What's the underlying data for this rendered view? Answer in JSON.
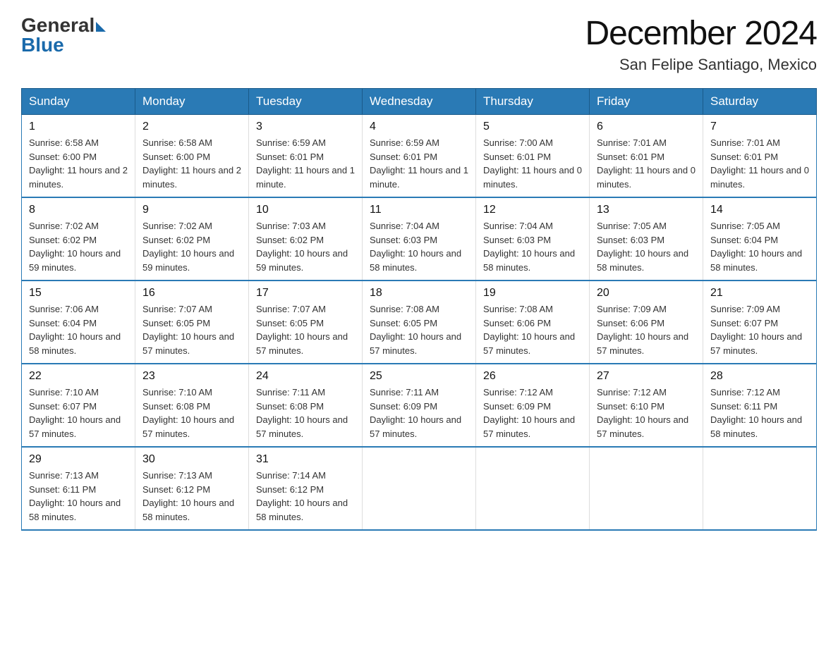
{
  "header": {
    "logo_general": "General",
    "logo_blue": "Blue",
    "month_title": "December 2024",
    "location": "San Felipe Santiago, Mexico"
  },
  "weekdays": [
    "Sunday",
    "Monday",
    "Tuesday",
    "Wednesday",
    "Thursday",
    "Friday",
    "Saturday"
  ],
  "weeks": [
    [
      {
        "day": "1",
        "sunrise": "6:58 AM",
        "sunset": "6:00 PM",
        "daylight": "11 hours and 2 minutes."
      },
      {
        "day": "2",
        "sunrise": "6:58 AM",
        "sunset": "6:00 PM",
        "daylight": "11 hours and 2 minutes."
      },
      {
        "day": "3",
        "sunrise": "6:59 AM",
        "sunset": "6:01 PM",
        "daylight": "11 hours and 1 minute."
      },
      {
        "day": "4",
        "sunrise": "6:59 AM",
        "sunset": "6:01 PM",
        "daylight": "11 hours and 1 minute."
      },
      {
        "day": "5",
        "sunrise": "7:00 AM",
        "sunset": "6:01 PM",
        "daylight": "11 hours and 0 minutes."
      },
      {
        "day": "6",
        "sunrise": "7:01 AM",
        "sunset": "6:01 PM",
        "daylight": "11 hours and 0 minutes."
      },
      {
        "day": "7",
        "sunrise": "7:01 AM",
        "sunset": "6:01 PM",
        "daylight": "11 hours and 0 minutes."
      }
    ],
    [
      {
        "day": "8",
        "sunrise": "7:02 AM",
        "sunset": "6:02 PM",
        "daylight": "10 hours and 59 minutes."
      },
      {
        "day": "9",
        "sunrise": "7:02 AM",
        "sunset": "6:02 PM",
        "daylight": "10 hours and 59 minutes."
      },
      {
        "day": "10",
        "sunrise": "7:03 AM",
        "sunset": "6:02 PM",
        "daylight": "10 hours and 59 minutes."
      },
      {
        "day": "11",
        "sunrise": "7:04 AM",
        "sunset": "6:03 PM",
        "daylight": "10 hours and 58 minutes."
      },
      {
        "day": "12",
        "sunrise": "7:04 AM",
        "sunset": "6:03 PM",
        "daylight": "10 hours and 58 minutes."
      },
      {
        "day": "13",
        "sunrise": "7:05 AM",
        "sunset": "6:03 PM",
        "daylight": "10 hours and 58 minutes."
      },
      {
        "day": "14",
        "sunrise": "7:05 AM",
        "sunset": "6:04 PM",
        "daylight": "10 hours and 58 minutes."
      }
    ],
    [
      {
        "day": "15",
        "sunrise": "7:06 AM",
        "sunset": "6:04 PM",
        "daylight": "10 hours and 58 minutes."
      },
      {
        "day": "16",
        "sunrise": "7:07 AM",
        "sunset": "6:05 PM",
        "daylight": "10 hours and 57 minutes."
      },
      {
        "day": "17",
        "sunrise": "7:07 AM",
        "sunset": "6:05 PM",
        "daylight": "10 hours and 57 minutes."
      },
      {
        "day": "18",
        "sunrise": "7:08 AM",
        "sunset": "6:05 PM",
        "daylight": "10 hours and 57 minutes."
      },
      {
        "day": "19",
        "sunrise": "7:08 AM",
        "sunset": "6:06 PM",
        "daylight": "10 hours and 57 minutes."
      },
      {
        "day": "20",
        "sunrise": "7:09 AM",
        "sunset": "6:06 PM",
        "daylight": "10 hours and 57 minutes."
      },
      {
        "day": "21",
        "sunrise": "7:09 AM",
        "sunset": "6:07 PM",
        "daylight": "10 hours and 57 minutes."
      }
    ],
    [
      {
        "day": "22",
        "sunrise": "7:10 AM",
        "sunset": "6:07 PM",
        "daylight": "10 hours and 57 minutes."
      },
      {
        "day": "23",
        "sunrise": "7:10 AM",
        "sunset": "6:08 PM",
        "daylight": "10 hours and 57 minutes."
      },
      {
        "day": "24",
        "sunrise": "7:11 AM",
        "sunset": "6:08 PM",
        "daylight": "10 hours and 57 minutes."
      },
      {
        "day": "25",
        "sunrise": "7:11 AM",
        "sunset": "6:09 PM",
        "daylight": "10 hours and 57 minutes."
      },
      {
        "day": "26",
        "sunrise": "7:12 AM",
        "sunset": "6:09 PM",
        "daylight": "10 hours and 57 minutes."
      },
      {
        "day": "27",
        "sunrise": "7:12 AM",
        "sunset": "6:10 PM",
        "daylight": "10 hours and 57 minutes."
      },
      {
        "day": "28",
        "sunrise": "7:12 AM",
        "sunset": "6:11 PM",
        "daylight": "10 hours and 58 minutes."
      }
    ],
    [
      {
        "day": "29",
        "sunrise": "7:13 AM",
        "sunset": "6:11 PM",
        "daylight": "10 hours and 58 minutes."
      },
      {
        "day": "30",
        "sunrise": "7:13 AM",
        "sunset": "6:12 PM",
        "daylight": "10 hours and 58 minutes."
      },
      {
        "day": "31",
        "sunrise": "7:14 AM",
        "sunset": "6:12 PM",
        "daylight": "10 hours and 58 minutes."
      },
      null,
      null,
      null,
      null
    ]
  ],
  "labels": {
    "sunrise": "Sunrise:",
    "sunset": "Sunset:",
    "daylight": "Daylight:"
  }
}
